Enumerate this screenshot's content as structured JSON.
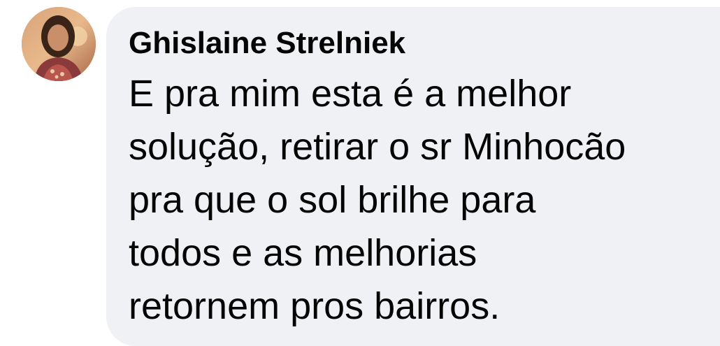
{
  "comment": {
    "avatar_icon": "user-photo-avatar",
    "author_name": "Ghislaine Strelniek",
    "text_lines": [
      "E pra mim esta é a melhor",
      "solução, retirar o sr Minhocão",
      "pra que o sol brilhe para",
      "todos e as melhorias",
      "retornem pros bairros."
    ]
  },
  "colors": {
    "bubble_background": "#eff1f4",
    "text": "#050505",
    "page_background": "#ffffff"
  }
}
